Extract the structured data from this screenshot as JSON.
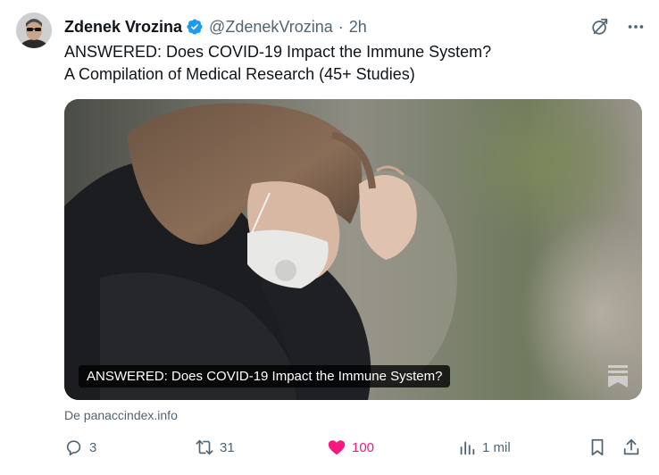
{
  "author": {
    "name": "Zdenek Vrozina",
    "handle": "@ZdenekVrozina",
    "separator": "·",
    "time": "2h",
    "verified": true
  },
  "tweet": {
    "line1": "ANSWERED: Does COVID-19 Impact the Immune System?",
    "line2": "A Compilation of Medical Research (45+ Studies)"
  },
  "card": {
    "caption": "ANSWERED: Does COVID-19 Impact the Immune System?",
    "source": "De panaccindex.info"
  },
  "actions": {
    "replies": "3",
    "retweets": "31",
    "likes": "100",
    "views": "1 mil"
  },
  "icons": {
    "verified": "verified-badge-icon",
    "grok": "grok-icon",
    "more": "more-icon",
    "reply": "reply-icon",
    "retweet": "retweet-icon",
    "like": "heart-icon",
    "views": "views-icon",
    "bookmark": "bookmark-icon",
    "share": "share-icon"
  },
  "colors": {
    "verified": "#1d9bf0",
    "like": "#f91880",
    "muted": "#536471",
    "text": "#0f1419"
  }
}
